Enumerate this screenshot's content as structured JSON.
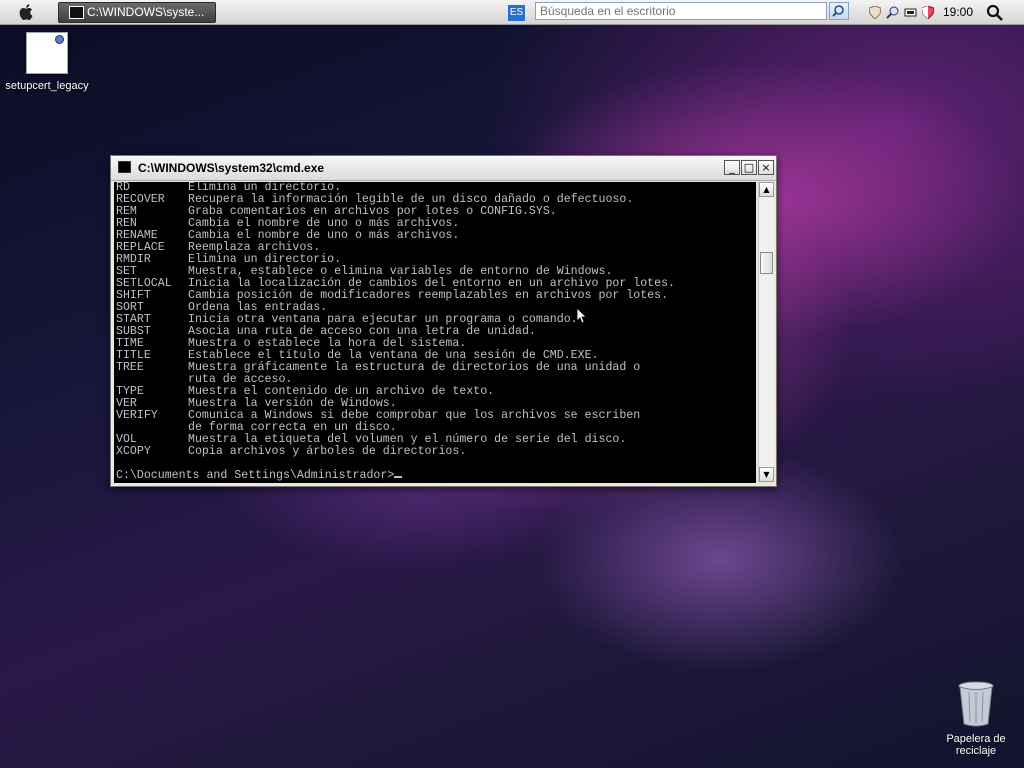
{
  "menubar": {
    "task_button_label": "C:\\WINDOWS\\syste...",
    "language_indicator": "ES",
    "search_placeholder": "Búsqueda en el escritorio",
    "clock": "19:00"
  },
  "desktop": {
    "icons": [
      {
        "label": "setupcert_legacy"
      },
      {
        "label": "Papelera de reciclaje"
      }
    ]
  },
  "cmd_window": {
    "title": "C:\\WINDOWS\\system32\\cmd.exe",
    "lines": [
      {
        "cmd": "RD",
        "desc": "Elimina un directorio."
      },
      {
        "cmd": "RECOVER",
        "desc": "Recupera la información legible de un disco dañado o defectuoso."
      },
      {
        "cmd": "REM",
        "desc": "Graba comentarios en archivos por lotes o CONFIG.SYS."
      },
      {
        "cmd": "REN",
        "desc": "Cambia el nombre de uno o más archivos."
      },
      {
        "cmd": "RENAME",
        "desc": "Cambia el nombre de uno o más archivos."
      },
      {
        "cmd": "REPLACE",
        "desc": "Reemplaza archivos."
      },
      {
        "cmd": "RMDIR",
        "desc": "Elimina un directorio."
      },
      {
        "cmd": "SET",
        "desc": "Muestra, establece o elimina variables de entorno de Windows."
      },
      {
        "cmd": "SETLOCAL",
        "desc": "Inicia la localización de cambios del entorno en un archivo por lotes."
      },
      {
        "cmd": "SHIFT",
        "desc": "Cambia posición de modificadores reemplazables en archivos por lotes."
      },
      {
        "cmd": "SORT",
        "desc": "Ordena las entradas."
      },
      {
        "cmd": "START",
        "desc": "Inicia otra ventana para ejecutar un programa o comando."
      },
      {
        "cmd": "SUBST",
        "desc": "Asocia una ruta de acceso con una letra de unidad."
      },
      {
        "cmd": "TIME",
        "desc": "Muestra o establece la hora del sistema."
      },
      {
        "cmd": "TITLE",
        "desc": "Establece el título de la ventana de una sesión de CMD.EXE."
      },
      {
        "cmd": "TREE",
        "desc": "Muestra gráficamente la estructura de directorios de una unidad o"
      },
      {
        "cmd": "",
        "desc": "ruta de acceso."
      },
      {
        "cmd": "TYPE",
        "desc": "Muestra el contenido de un archivo de texto."
      },
      {
        "cmd": "VER",
        "desc": "Muestra la versión de Windows."
      },
      {
        "cmd": "VERIFY",
        "desc": "Comunica a Windows si debe comprobar que los archivos se escriben"
      },
      {
        "cmd": "",
        "desc": "de forma correcta en un disco."
      },
      {
        "cmd": "VOL",
        "desc": "Muestra la etiqueta del volumen y el número de serie del disco."
      },
      {
        "cmd": "XCOPY",
        "desc": "Copia archivos y árboles de directorios."
      }
    ],
    "prompt": "C:\\Documents and Settings\\Administrador>",
    "buttons": {
      "minimize": "_",
      "maximize": "□",
      "close": "×"
    }
  }
}
